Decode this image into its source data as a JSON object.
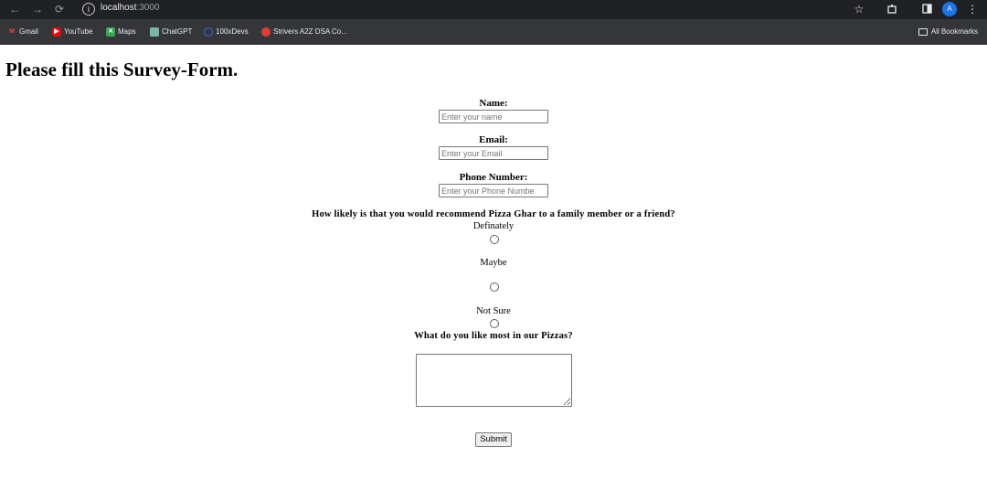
{
  "browser": {
    "url_host": "localhost",
    "url_port": ":3000",
    "avatar_letter": "A",
    "icons": {
      "back": "arrow-left-icon",
      "forward": "arrow-right-icon",
      "reload": "reload-icon",
      "site_info": "info-icon",
      "star": "star-icon",
      "extensions": "puzzle-icon",
      "sidepanel": "sidepanel-icon",
      "menu": "kebab-menu-icon"
    }
  },
  "bookmarks": {
    "items": [
      {
        "label": "Gmail",
        "icon": "gmail-icon",
        "color": "#ea4335"
      },
      {
        "label": "YouTube",
        "icon": "youtube-icon",
        "color": "#ff0000"
      },
      {
        "label": "Maps",
        "icon": "maps-icon",
        "color": "#34a853"
      },
      {
        "label": "ChatGPT",
        "icon": "chatgpt-icon",
        "color": "#10a37f"
      },
      {
        "label": "100xDevs",
        "icon": "100xdevs-icon",
        "color": "#2f6fed"
      },
      {
        "label": "Strivers A2Z DSA Co...",
        "icon": "striver-icon",
        "color": "#e53935"
      }
    ],
    "all_bookmarks": "All Bookmarks"
  },
  "form": {
    "heading": "Please fill this Survey-Form.",
    "name_label": "Name:",
    "name_placeholder": "Enter your name",
    "email_label": "Email:",
    "email_placeholder": "Enter your Email",
    "phone_label": "Phone Number:",
    "phone_placeholder": "Enter your Phone Numbe",
    "question": "How likely is that you would recommend Pizza Ghar to a family member or a friend?",
    "options": [
      "Definately",
      "Maybe",
      "Not Sure"
    ],
    "like_question": "What do you like most in our Pizzas?",
    "submit_label": "Submit"
  }
}
